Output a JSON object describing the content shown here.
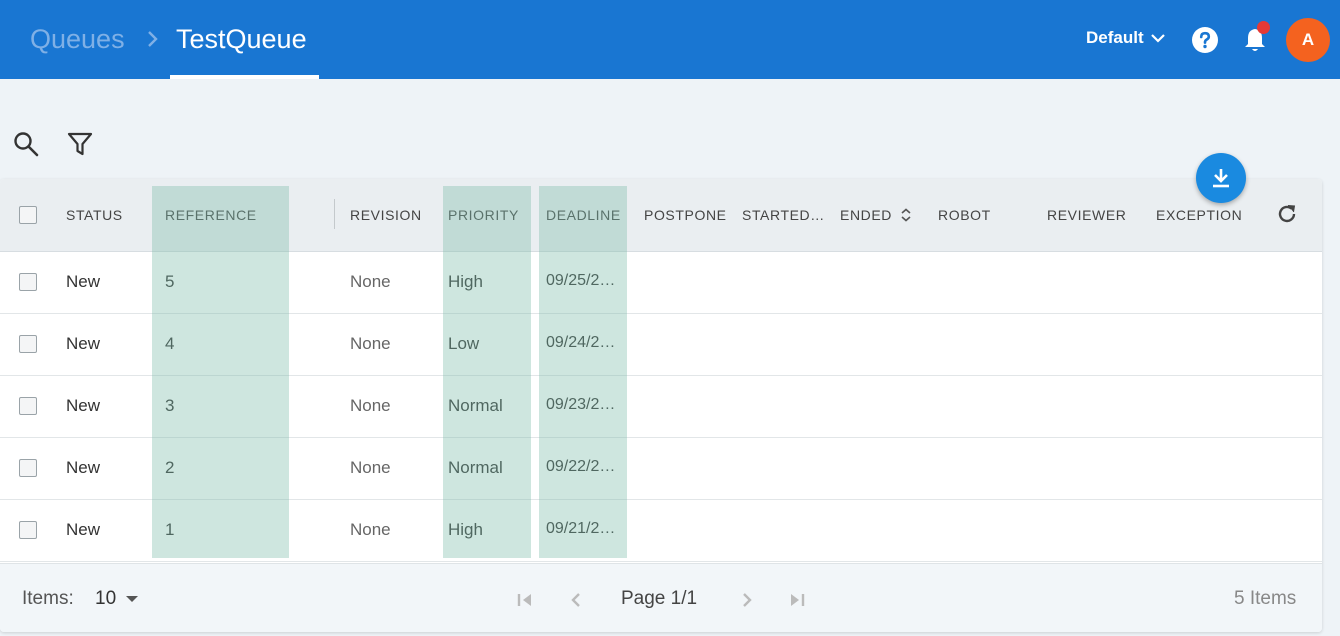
{
  "header": {
    "breadcrumb_parent": "Queues",
    "breadcrumb_current": "TestQueue",
    "tenant": "Default",
    "avatar_initial": "A",
    "colors": {
      "bar": "#1976d2",
      "avatar": "#f4621f",
      "notification_dot": "#e53935"
    }
  },
  "toolbar": {
    "search_icon": "search-icon",
    "filter_icon": "filter-icon",
    "download_icon": "download-icon"
  },
  "table": {
    "columns": [
      "STATUS",
      "REFERENCE",
      "REVISION",
      "PRIORITY",
      "DEADLINE",
      "POSTPONE",
      "STARTED…",
      "ENDED",
      "ROBOT",
      "REVIEWER",
      "EXCEPTION"
    ],
    "rows": [
      {
        "status": "New",
        "reference": "5",
        "revision": "None",
        "priority": "High",
        "deadline": "09/25/2…"
      },
      {
        "status": "New",
        "reference": "4",
        "revision": "None",
        "priority": "Low",
        "deadline": "09/24/2…"
      },
      {
        "status": "New",
        "reference": "3",
        "revision": "None",
        "priority": "Normal",
        "deadline": "09/23/2…"
      },
      {
        "status": "New",
        "reference": "2",
        "revision": "None",
        "priority": "Normal",
        "deadline": "09/22/2…"
      },
      {
        "status": "New",
        "reference": "1",
        "revision": "None",
        "priority": "High",
        "deadline": "09/21/2…"
      }
    ]
  },
  "footer": {
    "items_label": "Items:",
    "items_per_page": "10",
    "page": "Page 1/1",
    "total": "5 Items"
  }
}
